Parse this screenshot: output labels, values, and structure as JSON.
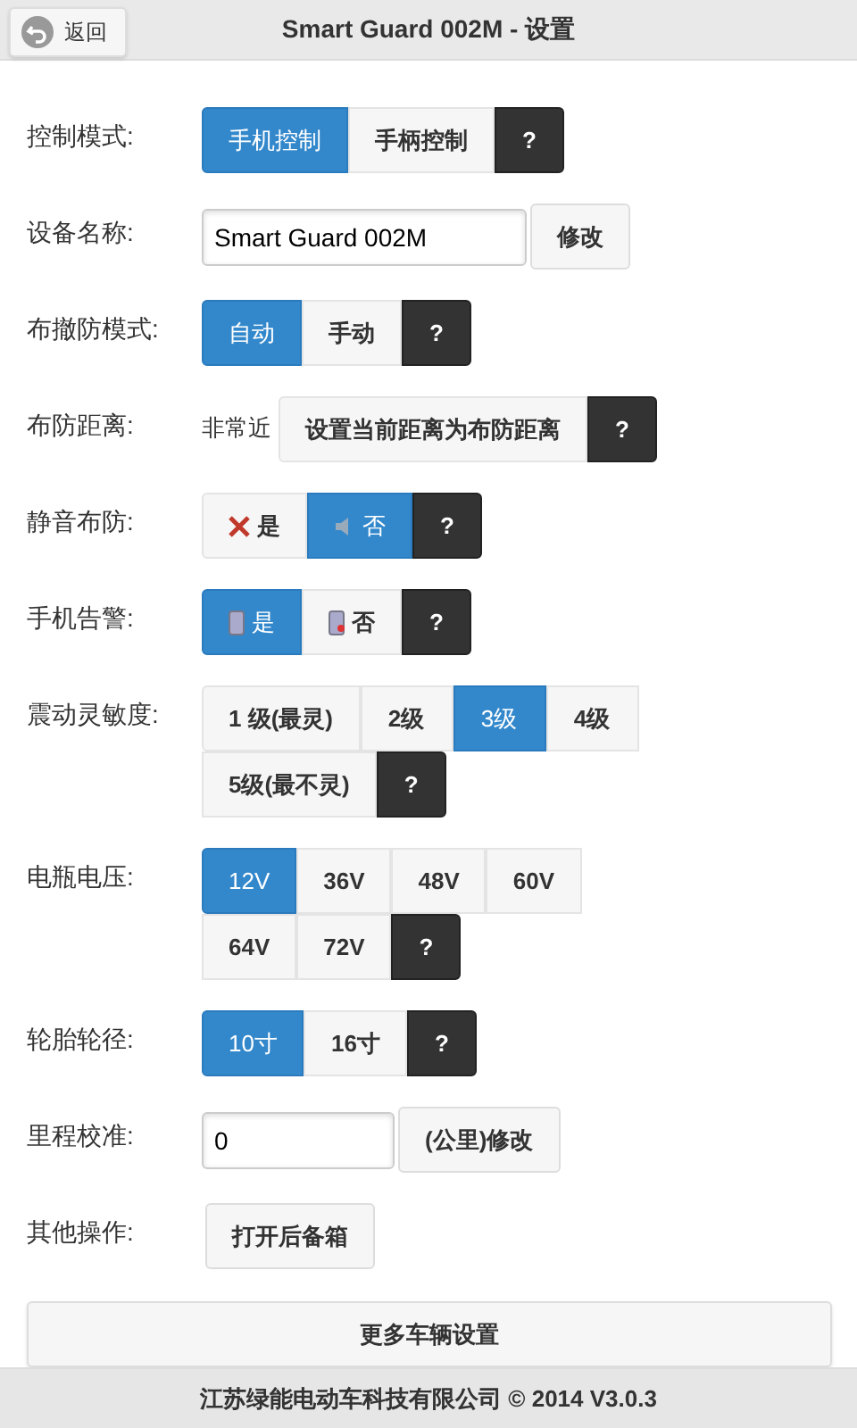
{
  "header": {
    "back": "返回",
    "title": "Smart Guard 002M - 设置"
  },
  "rows": [
    {
      "kind": "choice",
      "label": "控制模式:",
      "options": [
        {
          "label": "手机控制",
          "selected": true
        },
        {
          "label": "手柄控制",
          "selected": false
        }
      ],
      "help": "?"
    },
    {
      "kind": "edit",
      "label": "设备名称:",
      "value": "Smart Guard 002M",
      "button": "修改"
    },
    {
      "kind": "choice",
      "label": "布撤防模式:",
      "options": [
        {
          "label": "自动",
          "selected": true
        },
        {
          "label": "手动",
          "selected": false
        }
      ],
      "help": "?"
    },
    {
      "kind": "distance",
      "label": "布防距离:",
      "reading": "非常近",
      "button": "设置当前距离为布防距离",
      "help": "?"
    },
    {
      "kind": "speaker-choice",
      "label": "静音布防:",
      "options": [
        {
          "label": "是",
          "selected": false
        },
        {
          "label": "否",
          "selected": true
        }
      ],
      "help": "?"
    },
    {
      "kind": "phone-choice",
      "label": "手机告警:",
      "options": [
        {
          "label": "是",
          "selected": true
        },
        {
          "label": "否",
          "selected": false
        }
      ],
      "help": "?"
    },
    {
      "kind": "choice",
      "label": "震动灵敏度:",
      "options": [
        {
          "label": "1 级(最灵)",
          "selected": false
        },
        {
          "label": "2级",
          "selected": false
        },
        {
          "label": "3级",
          "selected": true
        },
        {
          "label": "4级",
          "selected": false
        },
        {
          "label": "5级(最不灵)",
          "selected": false
        }
      ],
      "help": "?"
    },
    {
      "kind": "choice",
      "label": "电瓶电压:",
      "options": [
        {
          "label": "12V",
          "selected": true
        },
        {
          "label": "36V",
          "selected": false
        },
        {
          "label": "48V",
          "selected": false
        },
        {
          "label": "60V",
          "selected": false
        },
        {
          "label": "64V",
          "selected": false
        },
        {
          "label": "72V",
          "selected": false
        }
      ],
      "help": "?"
    },
    {
      "kind": "choice",
      "label": "轮胎轮径:",
      "options": [
        {
          "label": "10寸",
          "selected": true
        },
        {
          "label": "16寸",
          "selected": false
        }
      ],
      "help": "?"
    },
    {
      "kind": "edit-narrow",
      "label": "里程校准:",
      "value": "0",
      "button": "(公里)修改"
    },
    {
      "kind": "action",
      "label": "其他操作:",
      "button": "打开后备箱"
    }
  ],
  "more_button": "更多车辆设置",
  "footer": "江苏绿能电动车科技有限公司 © 2014 V3.0.3"
}
